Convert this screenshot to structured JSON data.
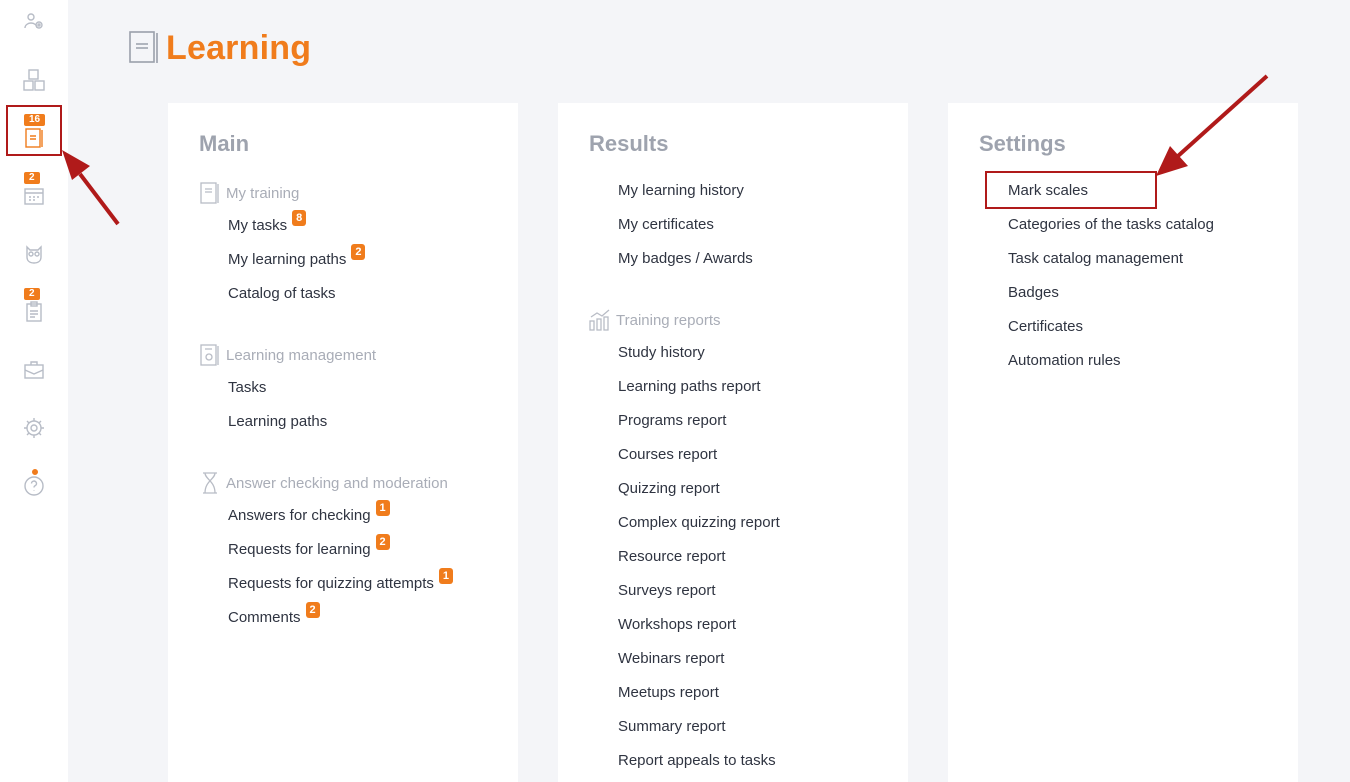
{
  "sidebar": {
    "items": [
      {
        "icon": "users-gear-icon"
      },
      {
        "icon": "abc-blocks-icon"
      },
      {
        "icon": "learning-book-icon",
        "badge": "16",
        "active": true
      },
      {
        "icon": "calendar-icon",
        "badge": "2"
      },
      {
        "icon": "owl-icon"
      },
      {
        "icon": "clipboard-icon",
        "badge": "2"
      },
      {
        "icon": "briefcase-icon"
      },
      {
        "icon": "gear-icon"
      },
      {
        "icon": "help-icon"
      }
    ]
  },
  "header": {
    "title": "Learning"
  },
  "main": {
    "title": "Main",
    "groups": [
      {
        "label": "My training",
        "icon": "book-icon",
        "items": [
          {
            "label": "My tasks",
            "count": "8"
          },
          {
            "label": "My learning paths",
            "count": "2"
          },
          {
            "label": "Catalog of tasks"
          }
        ]
      },
      {
        "label": "Learning management",
        "icon": "book-gear-icon",
        "items": [
          {
            "label": "Tasks"
          },
          {
            "label": "Learning paths"
          }
        ]
      },
      {
        "label": "Answer checking and moderation",
        "icon": "hourglass-icon",
        "items": [
          {
            "label": "Answers for checking",
            "count": "1"
          },
          {
            "label": "Requests for learning",
            "count": "2"
          },
          {
            "label": "Requests for quizzing attempts",
            "count": "1"
          },
          {
            "label": "Comments",
            "count": "2"
          }
        ]
      }
    ]
  },
  "results": {
    "title": "Results",
    "items": [
      {
        "label": "My learning history"
      },
      {
        "label": "My certificates"
      },
      {
        "label": "My badges / Awards"
      }
    ],
    "reports": {
      "label": "Training reports",
      "icon": "chart-icon",
      "items": [
        {
          "label": "Study history"
        },
        {
          "label": "Learning paths report"
        },
        {
          "label": "Programs report"
        },
        {
          "label": "Courses report"
        },
        {
          "label": "Quizzing report"
        },
        {
          "label": "Complex quizzing report"
        },
        {
          "label": "Resource report"
        },
        {
          "label": "Surveys report"
        },
        {
          "label": "Workshops report"
        },
        {
          "label": "Webinars report"
        },
        {
          "label": "Meetups report"
        },
        {
          "label": "Summary report"
        },
        {
          "label": "Report appeals to tasks"
        }
      ]
    }
  },
  "settings": {
    "title": "Settings",
    "items": [
      {
        "label": "Mark scales"
      },
      {
        "label": "Categories of the tasks catalog"
      },
      {
        "label": "Task catalog management"
      },
      {
        "label": "Badges"
      },
      {
        "label": "Certificates"
      },
      {
        "label": "Automation rules"
      }
    ]
  },
  "colors": {
    "accent": "#f07c1c",
    "highlight": "#b01a1a",
    "background": "#f4f5f8"
  }
}
